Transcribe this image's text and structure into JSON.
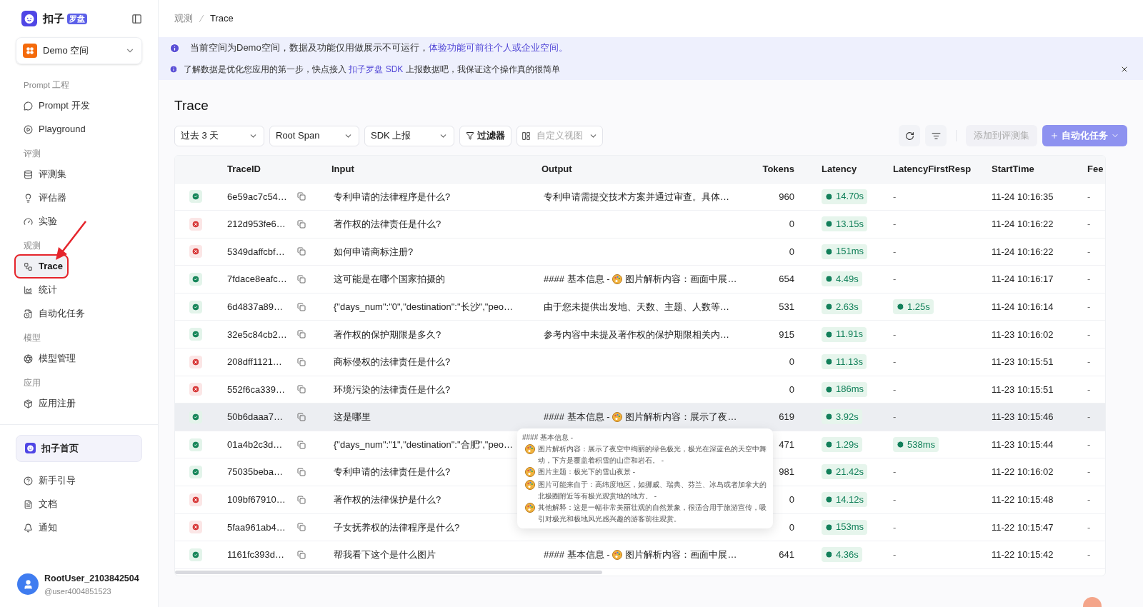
{
  "sidebar": {
    "logo": {
      "name": "扣子",
      "badge": "罗盘"
    },
    "workspace": "Demo 空间",
    "sections": [
      {
        "title": "Prompt 工程",
        "items": [
          {
            "label": "Prompt 开发",
            "selected": false,
            "annotated": false
          },
          {
            "label": "Playground",
            "selected": false,
            "annotated": false
          }
        ]
      },
      {
        "title": "评测",
        "items": [
          {
            "label": "评测集",
            "selected": false,
            "annotated": false
          },
          {
            "label": "评估器",
            "selected": false,
            "annotated": false
          },
          {
            "label": "实验",
            "selected": false,
            "annotated": false
          }
        ]
      },
      {
        "title": "观测",
        "items": [
          {
            "label": "Trace",
            "selected": true,
            "annotated": true
          },
          {
            "label": "统计",
            "selected": false,
            "annotated": false
          },
          {
            "label": "自动化任务",
            "selected": false,
            "annotated": false
          }
        ]
      },
      {
        "title": "模型",
        "items": [
          {
            "label": "模型管理",
            "selected": false,
            "annotated": false
          }
        ]
      },
      {
        "title": "应用",
        "items": [
          {
            "label": "应用注册",
            "selected": false,
            "annotated": false
          }
        ]
      }
    ],
    "home": "扣子首页",
    "links": [
      "新手引导",
      "文档",
      "通知"
    ],
    "user": {
      "name": "RootUser_2103842504",
      "handle": "@user4004851523"
    }
  },
  "breadcrumb": [
    "观测",
    "Trace"
  ],
  "banners": [
    {
      "before": "当前空间为Demo空间，数据及功能仅用做展示不可运行，",
      "link": "体验功能可前往个人或企业空间。",
      "closable": false
    },
    {
      "before": "了解数据是优化您应用的第一步，快点接入 ",
      "link": "扣子罗盘 SDK",
      "after": " 上报数据吧，我保证这个操作真的很简单",
      "closable": true
    }
  ],
  "title": "Trace",
  "filters": [
    "过去 3 天",
    "Root Span",
    "SDK 上报"
  ],
  "filter_button": "过滤器",
  "view_select": "自定义视图",
  "actions": [
    {
      "label": "添加到评测集",
      "kind": "secondary",
      "disabled": true
    },
    {
      "label": "自动化任务",
      "kind": "primary",
      "disabled": true
    }
  ],
  "table": {
    "columns": [
      "TraceID",
      "Input",
      "Output",
      "Tokens",
      "Latency",
      "LatencyFirstResp",
      "StartTime",
      "Fee"
    ],
    "rows": [
      {
        "succeeded": true,
        "id": "6e59ac7c54…",
        "input": "专利申请的法律程序是什么?",
        "output": {
          "before": "专利申请需提交技术方案并通过审查。具体…"
        },
        "tokens": "960",
        "latency": "14.70s",
        "first": "-",
        "time": "11-24 10:16:35",
        "fee": "-",
        "highlighted": false
      },
      {
        "succeeded": false,
        "id": "212d953fe6…",
        "input": "著作权的法律责任是什么?",
        "tokens": "0",
        "latency": "13.15s",
        "first": "-",
        "time": "11-24 10:16:22",
        "fee": "-",
        "highlighted": false
      },
      {
        "succeeded": false,
        "id": "5349daffcbf…",
        "input": "如何申请商标注册?",
        "tokens": "0",
        "latency": "151ms",
        "first": "-",
        "time": "11-24 10:16:22",
        "fee": "-",
        "highlighted": false
      },
      {
        "succeeded": true,
        "id": "7fdace8eafc…",
        "input": "这可能是在哪个国家拍摄的",
        "output": {
          "before": "#### 基本信息 -",
          "after": "图片解析内容：画面中展…"
        },
        "tokens": "654",
        "latency": "4.49s",
        "first": "-",
        "time": "11-24 10:16:17",
        "fee": "-",
        "highlighted": false
      },
      {
        "succeeded": true,
        "id": "6d4837a89…",
        "input": "{\"days_num\":\"0\",\"destination\":\"长沙\",\"peo…",
        "output": {
          "before": "由于您未提供出发地、天数、主题、人数等…"
        },
        "tokens": "531",
        "latency": "2.63s",
        "first": "1.25s",
        "time": "11-24 10:16:14",
        "fee": "-",
        "highlighted": false
      },
      {
        "succeeded": true,
        "id": "32e5c84cb2…",
        "input": "著作权的保护期限是多久?",
        "output": {
          "before": "参考内容中未提及著作权的保护期限相关内…"
        },
        "tokens": "915",
        "latency": "11.91s",
        "first": "-",
        "time": "11-23 10:16:02",
        "fee": "-",
        "highlighted": false
      },
      {
        "succeeded": false,
        "id": "208dff1121…",
        "input": "商标侵权的法律责任是什么?",
        "tokens": "0",
        "latency": "11.13s",
        "first": "-",
        "time": "11-23 10:15:51",
        "fee": "-",
        "highlighted": false
      },
      {
        "succeeded": false,
        "id": "552f6ca339…",
        "input": "环境污染的法律责任是什么?",
        "tokens": "0",
        "latency": "186ms",
        "first": "-",
        "time": "11-23 10:15:51",
        "fee": "-",
        "highlighted": false
      },
      {
        "succeeded": true,
        "id": "50b6daaa7…",
        "input": "这是哪里",
        "output": {
          "before": "#### 基本信息 -",
          "after": "图片解析内容：展示了夜…"
        },
        "tokens": "619",
        "latency": "3.92s",
        "first": "-",
        "time": "11-23 10:15:46",
        "fee": "-",
        "highlighted": true
      },
      {
        "succeeded": true,
        "id": "01a4b2c3d…",
        "input": "{\"days_num\":\"1\",\"destination\":\"合肥\",\"peo…",
        "tokens": "471",
        "latency": "1.29s",
        "first": "538ms",
        "time": "11-23 10:15:44",
        "fee": "-",
        "highlighted": false
      },
      {
        "succeeded": true,
        "id": "75035beba…",
        "input": "专利申请的法律责任是什么?",
        "tokens": "981",
        "latency": "21.42s",
        "first": "-",
        "time": "11-22 10:16:02",
        "fee": "-",
        "highlighted": false
      },
      {
        "succeeded": false,
        "id": "109bf67910…",
        "input": "著作权的法律保护是什么?",
        "tokens": "0",
        "latency": "14.12s",
        "first": "-",
        "time": "11-22 10:15:48",
        "fee": "-",
        "highlighted": false
      },
      {
        "succeeded": false,
        "id": "5faa961ab4…",
        "input": "子女抚养权的法律程序是什么?",
        "tokens": "0",
        "latency": "153ms",
        "first": "-",
        "time": "11-22 10:15:47",
        "fee": "-",
        "highlighted": false
      },
      {
        "succeeded": true,
        "id": "1161fc393d…",
        "input": "帮我看下这个是什么图片",
        "output": {
          "before": "#### 基本信息 -",
          "after": "图片解析内容：画面中展…"
        },
        "tokens": "641",
        "latency": "4.36s",
        "first": "-",
        "time": "11-22 10:15:42",
        "fee": "-",
        "highlighted": false
      }
    ]
  },
  "tooltip": [
    "#### 基本信息 -",
    "图片解析内容：展示了夜空中绚丽的绿色极光，极光在深蓝色的天空中舞动，下方是覆盖着积雪的山峦和岩石。 -",
    "图片主题：极光下的雪山夜景 -",
    "图片可能来自于：高纬度地区，如挪威、瑞典、芬兰、冰岛或者加拿大的北极圈附近等有极光观赏地的地方。 -",
    "其他解释：这是一幅非常美丽壮观的自然景象，很适合用于旅游宣传，吸引对极光和极地风光感兴趣的游客前往观赏。"
  ]
}
